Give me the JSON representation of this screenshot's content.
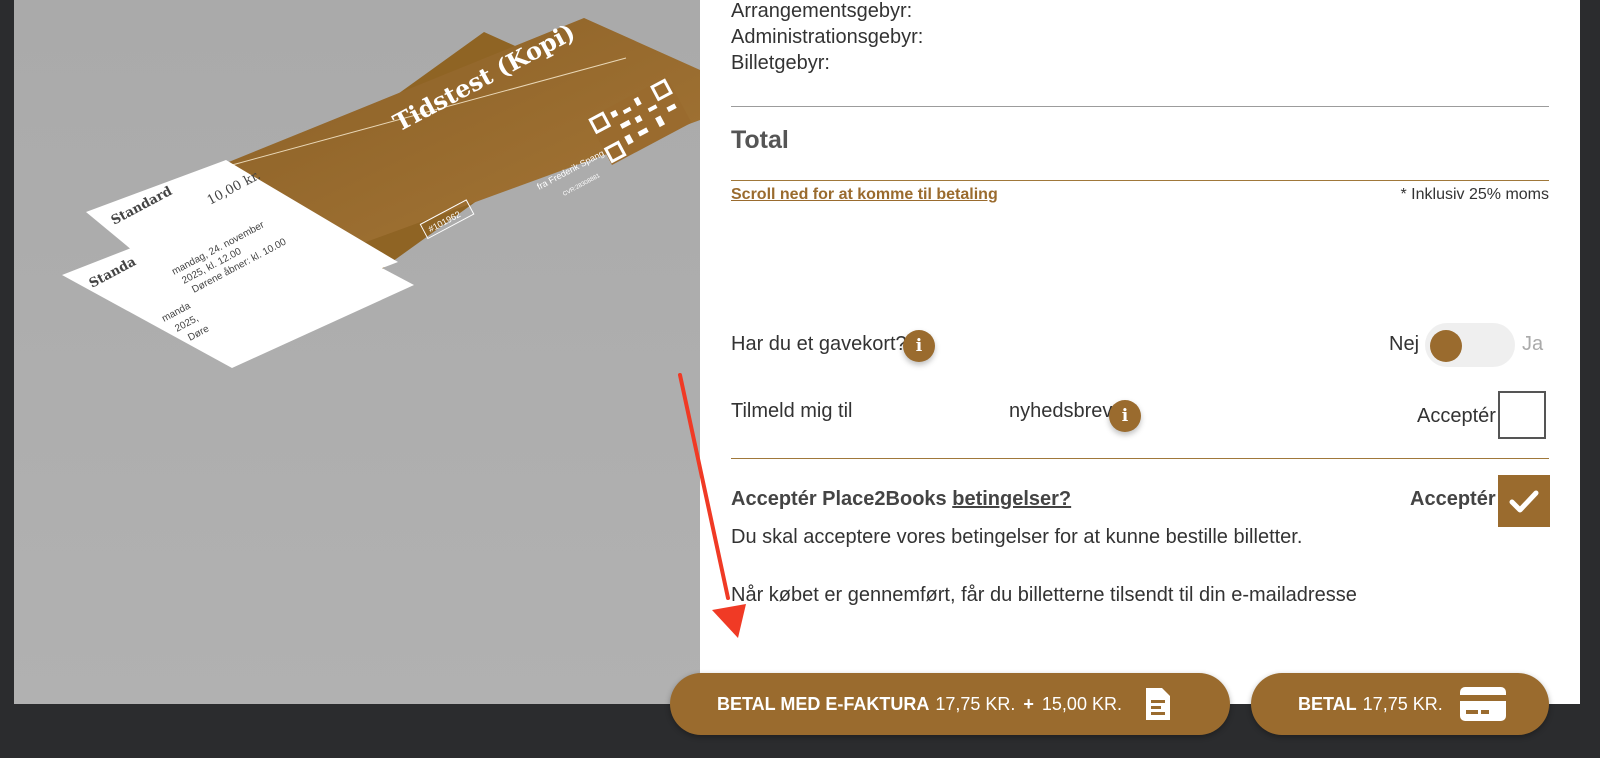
{
  "fees": {
    "arrangement": "Arrangementsgebyr:",
    "administration": "Administrationsgebyr:",
    "billet": "Billetgebyr:"
  },
  "total_label": "Total",
  "scroll_link": "Scroll ned for at komme til betaling",
  "vat_note": "* Inklusiv 25% moms",
  "giftcard": {
    "label": "Har du et gavekort?",
    "toggle_no": "Nej",
    "toggle_yes": "Ja",
    "toggle_value": "Nej"
  },
  "newsletter": {
    "label_start": "Tilmeld mig til",
    "label_end": "nyhedsbrev",
    "accept": "Acceptér",
    "checked": false
  },
  "terms": {
    "title_start": "Acceptér Place2Books",
    "title_link": "betingelser?",
    "accept": "Acceptér",
    "checked": true,
    "notice": "Du skal acceptere vores betingelser for at kunne bestille billetter.",
    "delivery": "Når købet er gennemført, får du billetterne tilsendt til din e-mailadresse"
  },
  "buttons": {
    "invoice": {
      "strong": "BETAL MED E-FAKTURA",
      "amount": "17,75 KR.",
      "plus": "+",
      "fee": "15,00 KR."
    },
    "card": {
      "strong": "BETAL",
      "amount": "17,75 KR."
    }
  },
  "ticket": {
    "title": "Tidstest (Kopi)",
    "type": "Standard",
    "price": "10,00 kr.",
    "date_line1": "mandag, 24. november",
    "date_line2": "2025, kl. 12.00",
    "doors": "Dørene åbner: kl. 10.00",
    "back_type": "Standa",
    "back_line1": "manda",
    "back_line2": "2025,",
    "back_line3": "Døre",
    "number": "#101962",
    "organizer": "fra Frederik Spang",
    "cvr": "CVR:28308881"
  },
  "colors": {
    "accent": "#9a6b2e",
    "background": "#2b2c2e",
    "arrow": "#f03a25"
  },
  "icons": {
    "info": "info-icon",
    "invoice": "document-icon",
    "card": "credit-card-icon",
    "check": "check-icon"
  }
}
